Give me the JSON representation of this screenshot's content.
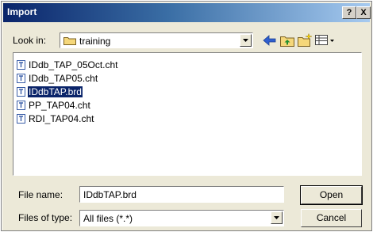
{
  "window": {
    "title": "Import",
    "help_label": "?",
    "close_label": "X"
  },
  "look_in": {
    "label": "Look in:",
    "folder": "training"
  },
  "toolbar": {
    "icons": [
      "back-arrow-icon",
      "up-folder-icon",
      "new-folder-icon",
      "views-menu-icon"
    ]
  },
  "files": [
    {
      "name": "IDdb_TAP_05Oct.cht",
      "selected": false
    },
    {
      "name": "IDdb_TAP05.cht",
      "selected": false
    },
    {
      "name": "IDdbTAP.brd",
      "selected": true
    },
    {
      "name": "PP_TAP04.cht",
      "selected": false
    },
    {
      "name": "RDI_TAP04.cht",
      "selected": false
    }
  ],
  "file_name": {
    "label": "File name:",
    "value": "IDdbTAP.brd"
  },
  "file_type": {
    "label": "Files of type:",
    "value": "All files (*.*)"
  },
  "buttons": {
    "open": "Open",
    "cancel": "Cancel"
  },
  "colors": {
    "title_bar": "#0a246a",
    "dialog_bg": "#ece9d8",
    "selection": "#0a246a"
  }
}
